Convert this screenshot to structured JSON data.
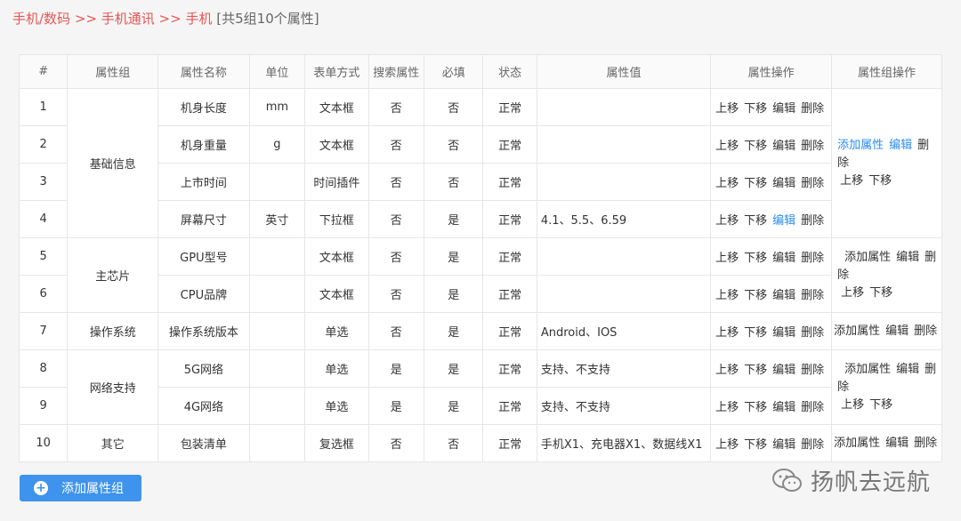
{
  "breadcrumb": {
    "level1": "手机/数码",
    "sep1": " >> ",
    "level2": "手机通讯",
    "sep2": " >> ",
    "level3": "手机",
    "summary": "[共5组10个属性]"
  },
  "table": {
    "headers": [
      "#",
      "属性组",
      "属性名称",
      "单位",
      "表单方式",
      "搜索属性",
      "必填",
      "状态",
      "属性值",
      "属性操作",
      "属性组操作"
    ],
    "rows": [
      {
        "no": "1",
        "name": "机身长度",
        "unit": "mm",
        "form": "文本框",
        "search": "否",
        "required": "否",
        "status": "正常",
        "values": ""
      },
      {
        "no": "2",
        "name": "机身重量",
        "unit": "g",
        "form": "文本框",
        "search": "否",
        "required": "否",
        "status": "正常",
        "values": ""
      },
      {
        "no": "3",
        "name": "上市时间",
        "unit": "",
        "form": "时间插件",
        "search": "否",
        "required": "否",
        "status": "正常",
        "values": ""
      },
      {
        "no": "4",
        "name": "屏幕尺寸",
        "unit": "英寸",
        "form": "下拉框",
        "search": "否",
        "required": "是",
        "status": "正常",
        "values": "4.1、5.5、6.59"
      },
      {
        "no": "5",
        "name": "GPU型号",
        "unit": "",
        "form": "文本框",
        "search": "否",
        "required": "是",
        "status": "正常",
        "values": ""
      },
      {
        "no": "6",
        "name": "CPU品牌",
        "unit": "",
        "form": "文本框",
        "search": "否",
        "required": "是",
        "status": "正常",
        "values": ""
      },
      {
        "no": "7",
        "name": "操作系统版本",
        "unit": "",
        "form": "单选",
        "search": "否",
        "required": "是",
        "status": "正常",
        "values": "Android、IOS"
      },
      {
        "no": "8",
        "name": "5G网络",
        "unit": "",
        "form": "单选",
        "search": "是",
        "required": "是",
        "status": "正常",
        "values": "支持、不支持"
      },
      {
        "no": "9",
        "name": "4G网络",
        "unit": "",
        "form": "单选",
        "search": "是",
        "required": "是",
        "status": "正常",
        "values": "支持、不支持"
      },
      {
        "no": "10",
        "name": "包装清单",
        "unit": "",
        "form": "复选框",
        "search": "否",
        "required": "否",
        "status": "正常",
        "values": "手机X1、充电器X1、数据线X1"
      }
    ],
    "groups": [
      "基础信息",
      "主芯片",
      "操作系统",
      "网络支持",
      "其它"
    ],
    "ops": {
      "up": "上移",
      "down": "下移",
      "edit": "编辑",
      "delete": "删除"
    },
    "group_ops": {
      "add": "添加属性",
      "edit": "编辑",
      "delete": "删除",
      "delete_split_a": "删",
      "delete_split_b": "除",
      "up": "上移",
      "down": "下移"
    }
  },
  "add_group_button": {
    "label": "添加属性组"
  },
  "watermark": {
    "text": "扬帆去远航"
  },
  "colors": {
    "accent": "#3e93ec",
    "red": "#e55656",
    "blue_link": "#2d8cf0"
  }
}
